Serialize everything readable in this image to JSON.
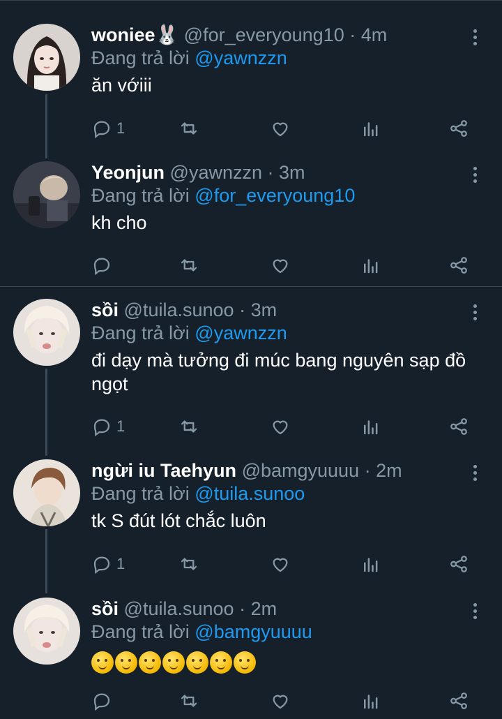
{
  "tweets": [
    {
      "name": "woniee🐰",
      "handle": "@for_everyoung10",
      "dot": "·",
      "time": "4m",
      "reply_prefix": "Đang trả lời",
      "mention": "@yawnzzn",
      "text": "ăn vớiii",
      "reply_count": "1",
      "avatar": "avatar-woniee"
    },
    {
      "name": "Yeonjun",
      "handle": "@yawnzzn",
      "dot": "·",
      "time": "3m",
      "reply_prefix": "Đang trả lời",
      "mention": "@for_everyoung10",
      "text": "kh cho",
      "reply_count": "",
      "avatar": "avatar-yeonjun"
    },
    {
      "name": "sồi",
      "handle": "@tuila.sunoo",
      "dot": "·",
      "time": "3m",
      "reply_prefix": "Đang trả lời",
      "mention": "@yawnzzn",
      "text": "đi dạy mà tưởng đi múc bang nguyên sạp đồ ngọt",
      "reply_count": "1",
      "avatar": "avatar-soi"
    },
    {
      "name": "ngừi iu Taehyun",
      "handle": "@bamgyuuuu",
      "dot": "·",
      "time": "2m",
      "reply_prefix": "Đang trả lời",
      "mention": "@tuila.sunoo",
      "text": "tk S đút lót chắc luôn",
      "reply_count": "1",
      "avatar": "avatar-taehyun"
    },
    {
      "name": "sồi",
      "handle": "@tuila.sunoo",
      "dot": "·",
      "time": "2m",
      "reply_prefix": "Đang trả lời",
      "mention": "@bamgyuuuu",
      "text": "😇🤨😌😏🤤😨😓",
      "reply_count": "",
      "avatar": "avatar-soi"
    }
  ],
  "icons": {
    "reply": "reply-icon",
    "retweet": "retweet-icon",
    "like": "heart-icon",
    "views": "analytics-icon",
    "share": "share-icon",
    "more": "more-vertical-icon"
  },
  "colors": {
    "background": "#15202b",
    "secondary_text": "#8899a6",
    "mention": "#1d9bf0",
    "divider": "#38444d"
  }
}
